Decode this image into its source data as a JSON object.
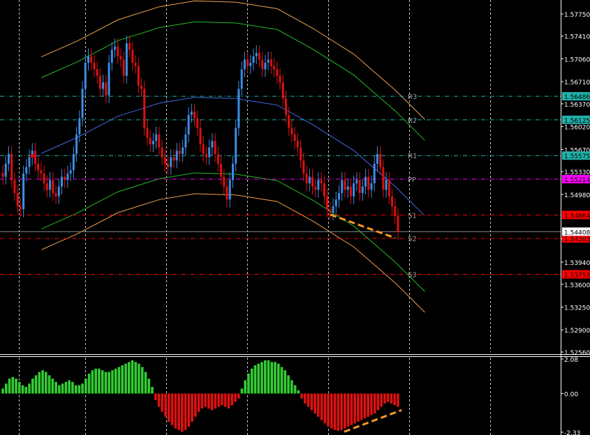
{
  "chart_data": [
    {
      "type": "candlestick",
      "price_axis": {
        "ticks": [
          "1.57750",
          "1.57410",
          "1.57060",
          "1.56710",
          "1.56370",
          "1.56020",
          "1.55670",
          "1.55330",
          "1.54980",
          "1.54300",
          "1.53940",
          "1.53600",
          "1.53250",
          "1.52900",
          "1.52560"
        ],
        "ylim": [
          1.5256,
          1.5791
        ]
      },
      "current_price": {
        "label": "1.54408",
        "value": 1.54408
      },
      "pivot_levels": [
        {
          "name": "R3",
          "label": "1.56486",
          "value": 1.56486,
          "color": "#20b2aa"
        },
        {
          "name": "R2",
          "label": "1.56125",
          "value": 1.56125,
          "color": "#20b2aa"
        },
        {
          "name": "R1",
          "label": "1.55575",
          "value": 1.55575,
          "color": "#20b2aa"
        },
        {
          "name": "PP",
          "label": "1.55214",
          "value": 1.55214,
          "color": "#ff00ff"
        },
        {
          "name": "S1",
          "label": "1.54664",
          "value": 1.54664,
          "color": "#ff0000"
        },
        {
          "name": "S2",
          "label": "1.54303",
          "value": 1.54303,
          "color": "#ff0000"
        },
        {
          "name": "S3",
          "label": "1.53753",
          "value": 1.53753,
          "color": "#ff0000"
        }
      ],
      "regression_channel": {
        "middle_color": "#4169e1",
        "inner_color": "#22bb22",
        "outer_color": "#f0a050",
        "middle_points": [
          [
            0.07,
            1.5561
          ],
          [
            0.13,
            1.5585
          ],
          [
            0.2,
            1.5618
          ],
          [
            0.27,
            1.5638
          ],
          [
            0.33,
            1.5647
          ],
          [
            0.4,
            1.5645
          ],
          [
            0.47,
            1.5635
          ],
          [
            0.53,
            1.5605
          ],
          [
            0.6,
            1.5565
          ],
          [
            0.67,
            1.551
          ],
          [
            0.72,
            1.5465
          ]
        ],
        "inner_offset": 0.0116,
        "outer_offset": 0.0148
      },
      "candles_close": [
        1.5525,
        1.5545,
        1.556,
        1.552,
        1.55,
        1.548,
        1.5475,
        1.553,
        1.554,
        1.5555,
        1.5565,
        1.5545,
        1.5535,
        1.553,
        1.5515,
        1.5505,
        1.552,
        1.55,
        1.5495,
        1.551,
        1.5525,
        1.552,
        1.553,
        1.5535,
        1.556,
        1.559,
        1.5615,
        1.566,
        1.57,
        1.571,
        1.57,
        1.569,
        1.568,
        1.566,
        1.567,
        1.565,
        1.57,
        1.572,
        1.5725,
        1.571,
        1.5705,
        1.568,
        1.573,
        1.572,
        1.57,
        1.5695,
        1.5665,
        1.566,
        1.56,
        1.5585,
        1.5575,
        1.558,
        1.559,
        1.557,
        1.5555,
        1.5545,
        1.554,
        1.5555,
        1.555,
        1.5565,
        1.556,
        1.557,
        1.559,
        1.562,
        1.5625,
        1.5615,
        1.56,
        1.5575,
        1.556,
        1.5555,
        1.557,
        1.558,
        1.556,
        1.5545,
        1.5525,
        1.551,
        1.549,
        1.552,
        1.5545,
        1.56,
        1.566,
        1.569,
        1.5705,
        1.5695,
        1.57,
        1.571,
        1.5715,
        1.5705,
        1.569,
        1.57,
        1.5705,
        1.5695,
        1.569,
        1.568,
        1.567,
        1.5645,
        1.562,
        1.56,
        1.559,
        1.558,
        1.557,
        1.555,
        1.553,
        1.5515,
        1.5525,
        1.551,
        1.5505,
        1.552,
        1.5515,
        1.5495,
        1.5475,
        1.547,
        1.548,
        1.549,
        1.55,
        1.552,
        1.5505,
        1.551,
        1.5495,
        1.5515,
        1.552,
        1.55,
        1.551,
        1.5525,
        1.5505,
        1.5515,
        1.5545,
        1.556,
        1.554,
        1.5505,
        1.552,
        1.5495,
        1.548,
        1.5465,
        1.544
      ],
      "marker_dot": {
        "index": 10,
        "value": 1.5557,
        "color": "#ff0000"
      },
      "trend_line_price": {
        "from": [
          0.56,
          1.5467
        ],
        "to": [
          0.67,
          1.5431
        ],
        "color": "#ff9922"
      }
    },
    {
      "type": "histogram",
      "axis_ticks": [
        "2.08",
        "0.00",
        "-2.33"
      ],
      "ylim": [
        -2.33,
        2.08
      ],
      "positive_color": "#33cc33",
      "negative_color": "#dd1111",
      "values": [
        0.3,
        0.6,
        0.9,
        1.0,
        0.9,
        0.7,
        0.5,
        0.4,
        0.6,
        0.9,
        1.1,
        1.3,
        1.4,
        1.3,
        1.1,
        0.9,
        0.7,
        0.5,
        0.6,
        0.7,
        0.8,
        0.7,
        0.5,
        0.5,
        0.6,
        0.9,
        1.2,
        1.4,
        1.5,
        1.5,
        1.4,
        1.3,
        1.3,
        1.4,
        1.5,
        1.6,
        1.7,
        1.8,
        1.9,
        2.0,
        1.9,
        1.8,
        1.6,
        1.3,
        0.9,
        0.4,
        -0.4,
        -0.8,
        -1.1,
        -1.4,
        -1.7,
        -1.9,
        -2.1,
        -2.2,
        -2.3,
        -2.2,
        -2.0,
        -1.7,
        -1.4,
        -1.1,
        -0.9,
        -0.8,
        -0.9,
        -1.0,
        -0.9,
        -0.8,
        -0.7,
        -0.8,
        -0.9,
        -0.7,
        -0.5,
        -0.3,
        0.3,
        0.8,
        1.2,
        1.5,
        1.7,
        1.8,
        1.9,
        2.0,
        2.0,
        1.9,
        1.9,
        1.8,
        1.6,
        1.4,
        1.1,
        0.8,
        0.5,
        0.2,
        -0.3,
        -0.6,
        -0.8,
        -1.0,
        -1.2,
        -1.4,
        -1.6,
        -1.8,
        -2.0,
        -2.1,
        -2.2,
        -2.25,
        -2.2,
        -2.1,
        -2.0,
        -1.9,
        -1.8,
        -1.7,
        -1.6,
        -1.5,
        -1.4,
        -1.3,
        -1.2,
        -1.0,
        -0.8,
        -0.6,
        -0.5,
        -0.6,
        -0.7,
        -0.8
      ],
      "trend_line": {
        "from": [
          -2.3,
          0.78
        ],
        "to": [
          -1.0,
          0.99
        ],
        "color": "#ff9922"
      }
    }
  ]
}
